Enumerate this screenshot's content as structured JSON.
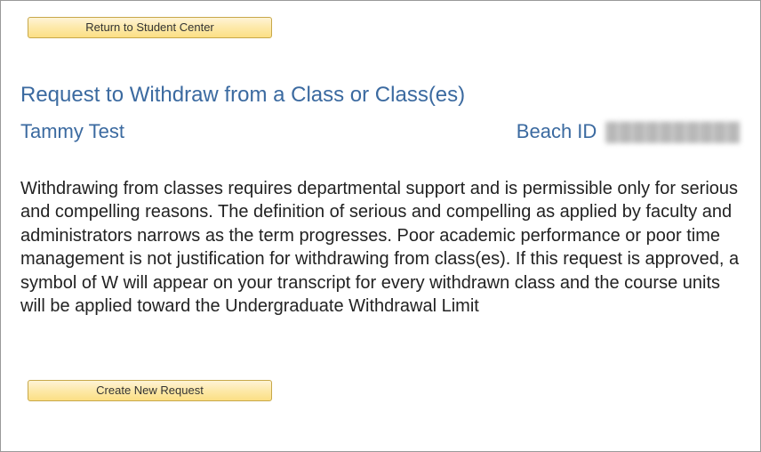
{
  "buttons": {
    "return_label": "Return to Student Center",
    "create_label": "Create New Request"
  },
  "header": {
    "page_title": "Request to Withdraw from a Class or Class(es)",
    "student_name": "Tammy Test",
    "beach_id_label": "Beach ID",
    "beach_id_value": "██████████"
  },
  "body": {
    "paragraph": "Withdrawing from classes requires departmental support and is permissible only for serious and compelling reasons. The definition of serious and compelling as applied by faculty and administrators narrows as the term progresses. Poor academic performance or poor time management is not justification for withdrawing from class(es). If this request is approved, a symbol of W will appear on your transcript for every withdrawn class and the course units will be applied toward the Undergraduate Withdrawal Limit"
  }
}
